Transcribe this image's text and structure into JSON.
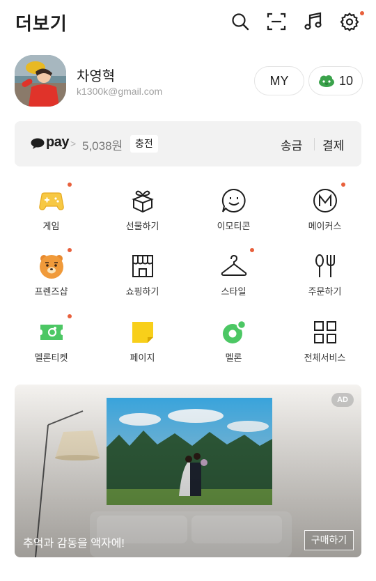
{
  "header": {
    "title": "더보기",
    "icons": [
      "search-icon",
      "scan-icon",
      "music-icon",
      "settings-icon"
    ],
    "settings_has_new": true
  },
  "profile": {
    "name": "차영혁",
    "email": "k1300k@gmail.com",
    "my_label": "MY",
    "emoticon_count": "10"
  },
  "pay": {
    "logo": "pay",
    "chevron": ">",
    "balance": "5,038원",
    "charge_label": "충전",
    "send_label": "송금",
    "pay_label": "결제"
  },
  "services": [
    {
      "label": "게임",
      "icon": "game-icon",
      "new": true
    },
    {
      "label": "선물하기",
      "icon": "gift-icon",
      "new": false
    },
    {
      "label": "이모티콘",
      "icon": "emoticon-icon",
      "new": false
    },
    {
      "label": "메이커스",
      "icon": "makers-icon",
      "new": true
    },
    {
      "label": "프렌즈샵",
      "icon": "friends-shop-icon",
      "new": true
    },
    {
      "label": "쇼핑하기",
      "icon": "shopping-icon",
      "new": false
    },
    {
      "label": "스타일",
      "icon": "style-hanger-icon",
      "new": true
    },
    {
      "label": "주문하기",
      "icon": "order-icon",
      "new": false
    },
    {
      "label": "멜론티켓",
      "icon": "melon-ticket-icon",
      "new": true
    },
    {
      "label": "페이지",
      "icon": "page-icon",
      "new": false
    },
    {
      "label": "멜론",
      "icon": "melon-icon",
      "new": false
    },
    {
      "label": "전체서비스",
      "icon": "all-services-icon",
      "new": false
    }
  ],
  "ad": {
    "badge": "AD",
    "caption": "추억과 감동을 액자에!",
    "cta": "구매하기"
  },
  "colors": {
    "accent_dot": "#e8603c",
    "pay_bar_bg": "#f2f2f2",
    "melon_green": "#4cc764",
    "game_yellow": "#f7c843",
    "page_yellow": "#f8cf1a"
  }
}
